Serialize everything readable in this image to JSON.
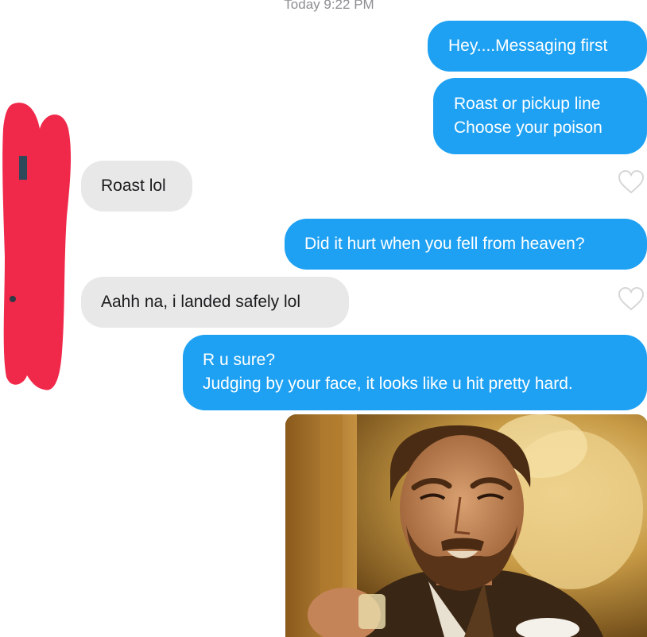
{
  "header": {
    "timestamp": "Today 9:22 PM"
  },
  "messages": [
    {
      "from": "me",
      "text": "Hey....Messaging first"
    },
    {
      "from": "me",
      "text": "Roast or pickup line\nChoose your poison"
    },
    {
      "from": "them",
      "text": "Roast lol"
    },
    {
      "from": "me",
      "text": "Did it hurt when you fell from heaven?"
    },
    {
      "from": "them",
      "text": "Aahh na, i landed safely lol"
    },
    {
      "from": "me",
      "text": "R u sure?\nJudging by your face, it looks like u hit pretty hard."
    }
  ],
  "attachment": {
    "type": "gif",
    "subject": "laughing-man-meme"
  },
  "colors": {
    "sent_bubble": "#1ea1f3",
    "received_bubble": "#e8e8e8",
    "redaction": "#f0284a",
    "heart_outline": "#d6d6d6"
  },
  "icons": {
    "like": "heart-outline-icon"
  }
}
